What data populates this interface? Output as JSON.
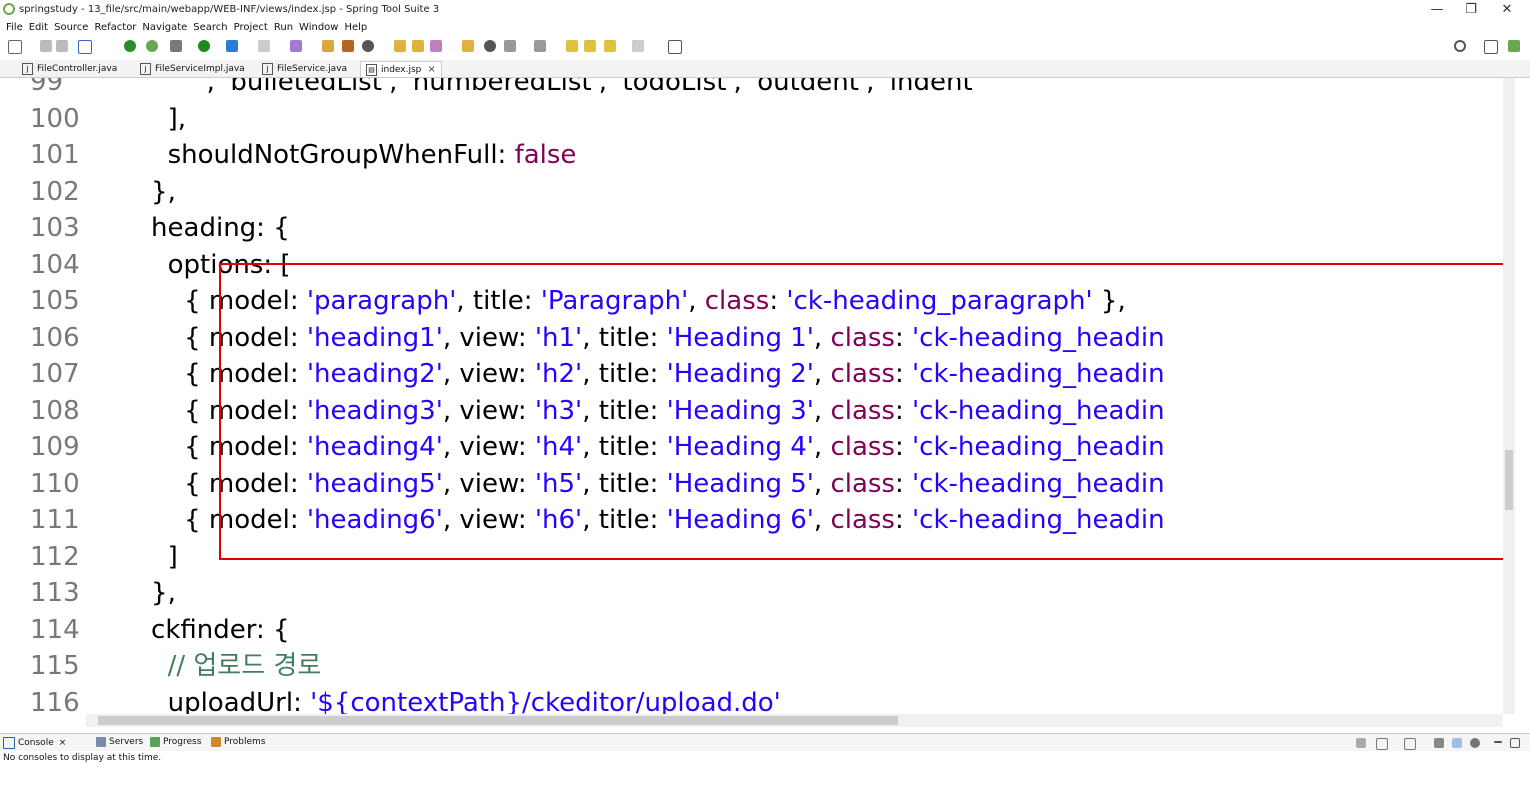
{
  "window": {
    "title": "springstudy - 13_file/src/main/webapp/WEB-INF/views/index.jsp - Spring Tool Suite 3",
    "minimize": "—",
    "maximize": "❐",
    "close": "✕"
  },
  "menu": [
    "File",
    "Edit",
    "Source",
    "Refactor",
    "Navigate",
    "Search",
    "Project",
    "Run",
    "Window",
    "Help"
  ],
  "editor_tabs": [
    {
      "label": "FileController.java",
      "icon": "java-file-icon",
      "active": false
    },
    {
      "label": "FileServiceImpl.java",
      "icon": "java-file-icon",
      "active": false
    },
    {
      "label": "FileService.java",
      "icon": "java-file-icon",
      "active": false
    },
    {
      "label": "index.jsp",
      "icon": "jsp-file-icon",
      "active": true,
      "close": "×"
    }
  ],
  "code_lines": [
    {
      "num": "99",
      "tokens": [
        [
          "p",
          "        ' ', 'bulletedList', 'numberedList', 'todoList', 'outdent', 'indent'"
        ]
      ]
    },
    {
      "num": "100",
      "tokens": [
        [
          "p",
          "      ],"
        ]
      ]
    },
    {
      "num": "101",
      "tokens": [
        [
          "p",
          "      shouldNotGroupWhenFull: "
        ],
        [
          "k",
          "false"
        ]
      ]
    },
    {
      "num": "102",
      "tokens": [
        [
          "p",
          "    },"
        ]
      ]
    },
    {
      "num": "103",
      "tokens": [
        [
          "p",
          "    heading: {"
        ]
      ]
    },
    {
      "num": "104",
      "tokens": [
        [
          "p",
          "      options: ["
        ]
      ]
    },
    {
      "num": "105",
      "tokens": [
        [
          "p",
          "        { model: "
        ],
        [
          "s",
          "'paragraph'"
        ],
        [
          "p",
          ", title: "
        ],
        [
          "s",
          "'Paragraph'"
        ],
        [
          "p",
          ", "
        ],
        [
          "k",
          "class"
        ],
        [
          "p",
          ": "
        ],
        [
          "s",
          "'ck-heading_paragraph'"
        ],
        [
          "p",
          " },"
        ]
      ]
    },
    {
      "num": "106",
      "tokens": [
        [
          "p",
          "        { model: "
        ],
        [
          "s",
          "'heading1'"
        ],
        [
          "p",
          ", view: "
        ],
        [
          "s",
          "'h1'"
        ],
        [
          "p",
          ", title: "
        ],
        [
          "s",
          "'Heading 1'"
        ],
        [
          "p",
          ", "
        ],
        [
          "k",
          "class"
        ],
        [
          "p",
          ": "
        ],
        [
          "s",
          "'ck-heading_headin"
        ]
      ]
    },
    {
      "num": "107",
      "tokens": [
        [
          "p",
          "        { model: "
        ],
        [
          "s",
          "'heading2'"
        ],
        [
          "p",
          ", view: "
        ],
        [
          "s",
          "'h2'"
        ],
        [
          "p",
          ", title: "
        ],
        [
          "s",
          "'Heading 2'"
        ],
        [
          "p",
          ", "
        ],
        [
          "k",
          "class"
        ],
        [
          "p",
          ": "
        ],
        [
          "s",
          "'ck-heading_headin"
        ]
      ]
    },
    {
      "num": "108",
      "tokens": [
        [
          "p",
          "        { model: "
        ],
        [
          "s",
          "'heading3'"
        ],
        [
          "p",
          ", view: "
        ],
        [
          "s",
          "'h3'"
        ],
        [
          "p",
          ", title: "
        ],
        [
          "s",
          "'Heading 3'"
        ],
        [
          "p",
          ", "
        ],
        [
          "k",
          "class"
        ],
        [
          "p",
          ": "
        ],
        [
          "s",
          "'ck-heading_headin"
        ]
      ]
    },
    {
      "num": "109",
      "tokens": [
        [
          "p",
          "        { model: "
        ],
        [
          "s",
          "'heading4'"
        ],
        [
          "p",
          ", view: "
        ],
        [
          "s",
          "'h4'"
        ],
        [
          "p",
          ", title: "
        ],
        [
          "s",
          "'Heading 4'"
        ],
        [
          "p",
          ", "
        ],
        [
          "k",
          "class"
        ],
        [
          "p",
          ": "
        ],
        [
          "s",
          "'ck-heading_headin"
        ]
      ]
    },
    {
      "num": "110",
      "tokens": [
        [
          "p",
          "        { model: "
        ],
        [
          "s",
          "'heading5'"
        ],
        [
          "p",
          ", view: "
        ],
        [
          "s",
          "'h5'"
        ],
        [
          "p",
          ", title: "
        ],
        [
          "s",
          "'Heading 5'"
        ],
        [
          "p",
          ", "
        ],
        [
          "k",
          "class"
        ],
        [
          "p",
          ": "
        ],
        [
          "s",
          "'ck-heading_headin"
        ]
      ]
    },
    {
      "num": "111",
      "tokens": [
        [
          "p",
          "        { model: "
        ],
        [
          "s",
          "'heading6'"
        ],
        [
          "p",
          ", view: "
        ],
        [
          "s",
          "'h6'"
        ],
        [
          "p",
          ", title: "
        ],
        [
          "s",
          "'Heading 6'"
        ],
        [
          "p",
          ", "
        ],
        [
          "k",
          "class"
        ],
        [
          "p",
          ": "
        ],
        [
          "s",
          "'ck-heading_headin"
        ]
      ]
    },
    {
      "num": "112",
      "tokens": [
        [
          "p",
          "      ]"
        ]
      ]
    },
    {
      "num": "113",
      "tokens": [
        [
          "p",
          "    },"
        ]
      ]
    },
    {
      "num": "114",
      "tokens": [
        [
          "p",
          "    ckfinder: {"
        ]
      ]
    },
    {
      "num": "115",
      "tokens": [
        [
          "c",
          "      // 업로드 경로"
        ]
      ]
    },
    {
      "num": "116",
      "tokens": [
        [
          "p",
          "      uploadUrl: "
        ],
        [
          "s",
          "'${contextPath}/ckeditor/upload.do'"
        ]
      ]
    }
  ],
  "bottom_panel": {
    "tabs": [
      {
        "label": "Console",
        "icon": "console-icon",
        "close": "×"
      },
      {
        "label": "Servers",
        "icon": "servers-icon"
      },
      {
        "label": "Progress",
        "icon": "progress-icon"
      },
      {
        "label": "Problems",
        "icon": "problems-icon"
      }
    ],
    "message": "No consoles to display at this time."
  },
  "colors": {
    "keyword": "#7f0055",
    "string": "#2a00ff",
    "comment": "#3f7f5f",
    "line_number": "#787878",
    "highlight_box": "#e00000"
  }
}
